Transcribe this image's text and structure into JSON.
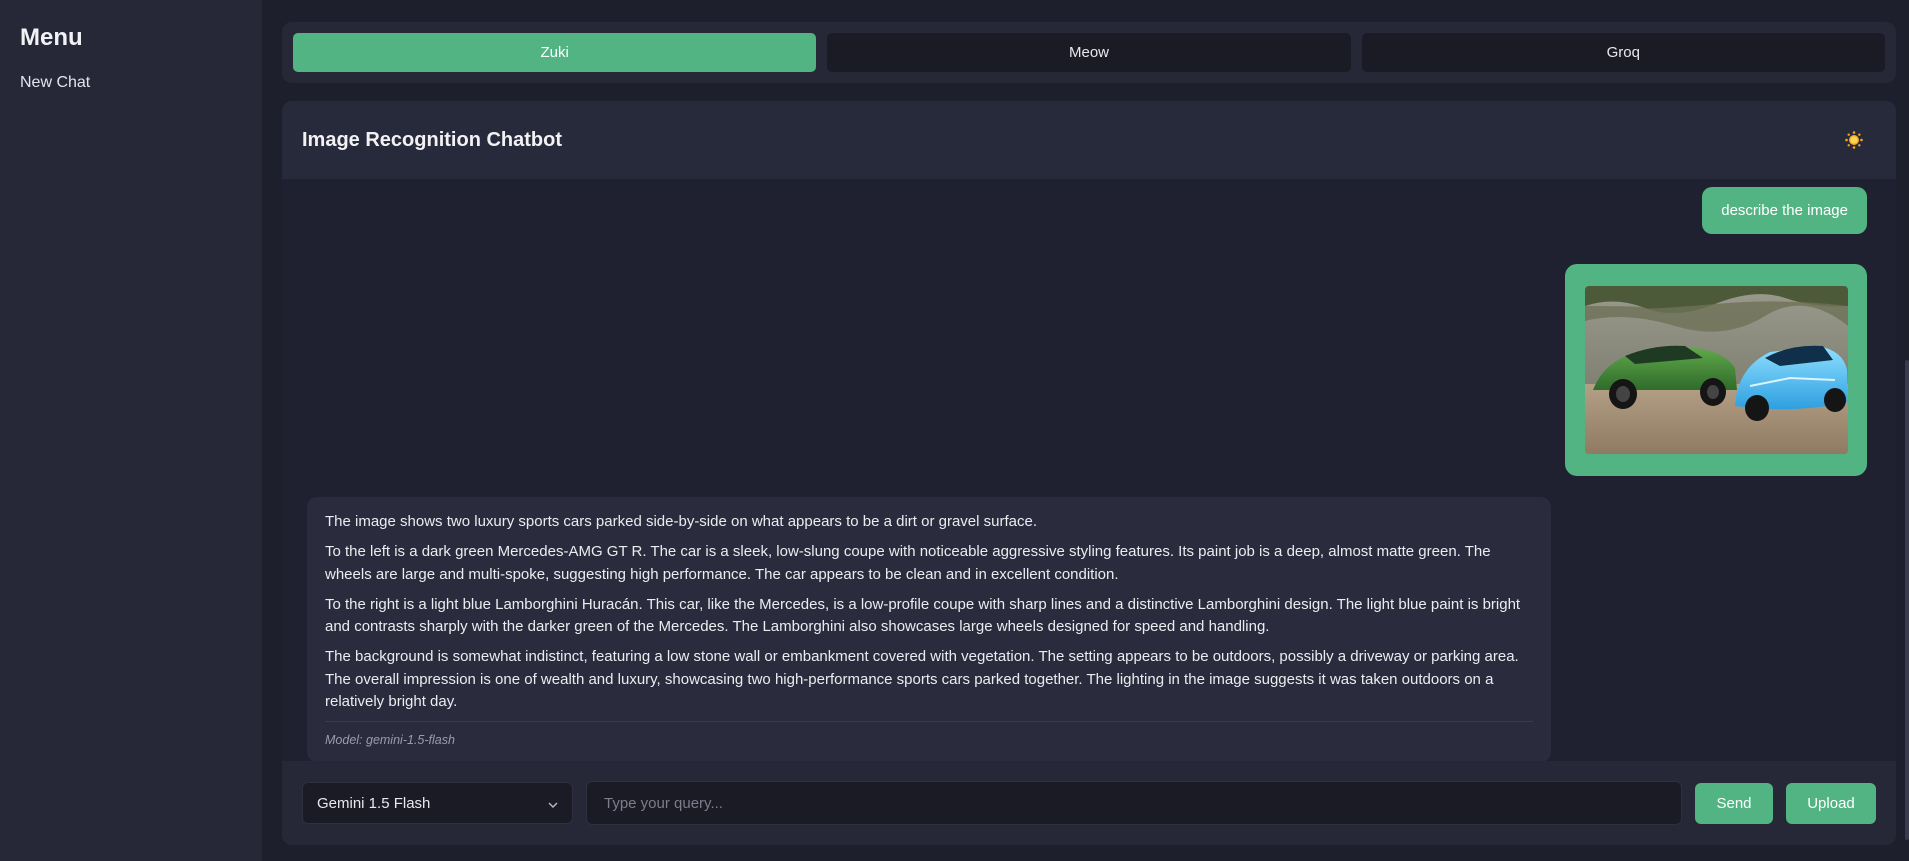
{
  "sidebar": {
    "title": "Menu",
    "items": [
      {
        "label": "New Chat"
      }
    ]
  },
  "tabs": [
    {
      "label": "Zuki",
      "active": true
    },
    {
      "label": "Meow",
      "active": false
    },
    {
      "label": "Groq",
      "active": false
    }
  ],
  "chat": {
    "title": "Image Recognition Chatbot",
    "theme_toggle_icon": "sun-icon",
    "messages": {
      "user_text": "describe the image",
      "user_image_icon": "car-photo",
      "bot_paragraphs": [
        "The image shows two luxury sports cars parked side-by-side on what appears to be a dirt or gravel surface.",
        "To the left is a dark green Mercedes-AMG GT R. The car is a sleek, low-slung coupe with noticeable aggressive styling features. Its paint job is a deep, almost matte green. The wheels are large and multi-spoke, suggesting high performance. The car appears to be clean and in excellent condition.",
        "To the right is a light blue Lamborghini Huracán. This car, like the Mercedes, is a low-profile coupe with sharp lines and a distinctive Lamborghini design. The light blue paint is bright and contrasts sharply with the darker green of the Mercedes. The Lamborghini also showcases large wheels designed for speed and handling.",
        "The background is somewhat indistinct, featuring a low stone wall or embankment covered with vegetation. The setting appears to be outdoors, possibly a driveway or parking area. The overall impression is one of wealth and luxury, showcasing two high-performance sports cars parked together. The lighting in the image suggests it was taken outdoors on a relatively bright day."
      ],
      "model_line": "Model: gemini-1.5-flash"
    }
  },
  "input": {
    "model_selected": "Gemini 1.5 Flash",
    "placeholder": "Type your query...",
    "value": "",
    "send_label": "Send",
    "upload_label": "Upload"
  },
  "colors": {
    "accent": "#52b483",
    "background": "#1e1f2c",
    "panel": "#262838"
  }
}
